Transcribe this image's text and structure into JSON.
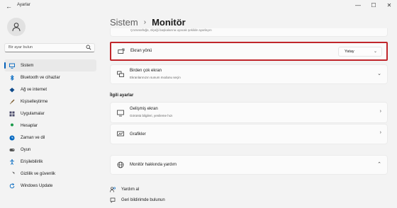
{
  "window": {
    "title": "Ayarlar",
    "back": "←",
    "minimize": "—",
    "maximize": "☐",
    "close": "✕"
  },
  "sidebar": {
    "search_placeholder": "Bir ayar bulun",
    "items": [
      {
        "label": "Sistem",
        "icon": "monitor-icon",
        "color": "#0067c0",
        "active": true
      },
      {
        "label": "Bluetooth ve cihazlar",
        "icon": "bluetooth-icon",
        "color": "#0067c0"
      },
      {
        "label": "Ağ ve internet",
        "icon": "wifi-icon",
        "color": "#0f4a8a"
      },
      {
        "label": "Kişiselleştirme",
        "icon": "brush-icon",
        "color": "#7a5a2c"
      },
      {
        "label": "Uygulamalar",
        "icon": "apps-icon",
        "color": "#4a4a6a"
      },
      {
        "label": "Hesaplar",
        "icon": "person-icon",
        "color": "#1a9a4a"
      },
      {
        "label": "Zaman ve dil",
        "icon": "globe-clock-icon",
        "color": "#0067c0"
      },
      {
        "label": "Oyun",
        "icon": "gamepad-icon",
        "color": "#555555"
      },
      {
        "label": "Erişilebilirlik",
        "icon": "accessibility-icon",
        "color": "#0067c0"
      },
      {
        "label": "Gizlilik ve güvenlik",
        "icon": "shield-icon",
        "color": "#5a5a5a"
      },
      {
        "label": "Windows Update",
        "icon": "update-icon",
        "color": "#0067c0"
      }
    ]
  },
  "header": {
    "parent": "Sistem",
    "separator": "›",
    "current": "Monitör"
  },
  "top_card": {
    "text": "Çözünürlüğü, ölçeği başkalarına uyacak şekilde ayarlayın"
  },
  "orientation": {
    "label": "Ekran yönü",
    "value": "Yatay",
    "chevron": "⌄",
    "highlight_color": "#c0262b"
  },
  "multi_display": {
    "title": "Birden çok ekran",
    "subtitle": "Ekranlarınızın sunum modunu seçin",
    "chevron": "⌄"
  },
  "related": {
    "header": "İlgili ayarlar",
    "items": [
      {
        "title": "Gelişmiş ekran",
        "subtitle": "Görüntü bilgileri, yenileme hızı",
        "icon": "monitor-icon",
        "chevron": "›"
      },
      {
        "title": "Grafikler",
        "subtitle": "",
        "icon": "graphics-icon",
        "chevron": "›"
      }
    ]
  },
  "help": {
    "title": "Monitör hakkında yardım",
    "chevron": "⌃"
  },
  "links": [
    {
      "label": "Yardım al",
      "icon": "help-person-icon"
    },
    {
      "label": "Geri bildirimde bulunun",
      "icon": "feedback-icon"
    }
  ],
  "accent": "#005fb8"
}
